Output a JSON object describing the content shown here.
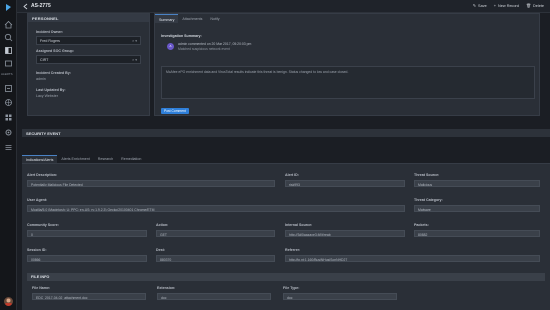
{
  "window": {
    "title": "AS-2775"
  },
  "topbar": {
    "actions": [
      {
        "icon": "save-icon",
        "glyph": "✎",
        "label": "Save"
      },
      {
        "icon": "plus-icon",
        "glyph": "+",
        "label": "New Record"
      },
      {
        "icon": "trash-icon",
        "glyph": "🗑",
        "label": "Delete"
      }
    ]
  },
  "rail": {
    "alert_label": "ALERTS",
    "icons": [
      "logo-icon",
      "home-icon",
      "search-icon",
      "app-icon",
      "workspace-icon",
      "alerts-icon",
      "grid-icon",
      "globe-icon",
      "list-icon",
      "gear-icon",
      "menu-icon"
    ]
  },
  "personnel": {
    "heading": "PERSONNEL",
    "owner_label": "Incident Owner:",
    "owner_value": "Fred Rogers",
    "group_label": "Assigned SOC Group:",
    "group_value": "CIRT",
    "created_label": "Incident Created By:",
    "created_value": "admin",
    "updated_label": "Last Updated By:",
    "updated_value": "Lacy Webster"
  },
  "summary": {
    "tabs": [
      "Summary",
      "Attachments",
      "Notify"
    ],
    "title": "Investigation Summary:",
    "comment_avatar": "A",
    "comment_meta": "admin commented on 20 Mar 2017, 05:20:03 pm",
    "comment_text": "Matched suspicious network event",
    "body": "McAfee ePO enrichment data and VirusTotal results indicate this threat is benign. Status changed to low and case closed.",
    "post_button": "Post Comment"
  },
  "security_event": {
    "heading": "SECURITY EVENT",
    "tabs": [
      "Indications/Alerts",
      "Alerts Enrichment",
      "Research",
      "Remediation"
    ],
    "fields": {
      "alert_desc_label": "Alert Description:",
      "alert_desc_value": "Potentially Malicious File Detected",
      "alert_id_label": "Alert ID:",
      "alert_id_value": "risk993",
      "threat_source_label": "Threat Source:",
      "threat_source_value": "Malicious",
      "user_agent_label": "User Agent:",
      "user_agent_value": "Mozilla/5.0 (Macintosh; U; PPC; en-US; rv:1.9.2.3) Gecko/20100401 Chrome/ETM",
      "threat_cat_label": "Threat Category:",
      "threat_cat_value": "Malware",
      "community_label": "Community Score:",
      "community_value": "0",
      "action_label": "Action:",
      "action_value": "GET",
      "internal_label": "Internal Source:",
      "internal_value": "http://3d0jaazaxe3.fi/i/t/reab",
      "packets_label": "Packets:",
      "packets_value": "80882",
      "session_label": "Session ID:",
      "session_value": "00866",
      "dest_label": "Dest:",
      "dest_value": "880370",
      "referrer_label": "Referrer:",
      "referrer_value": "http://ip.nt:1.160/BusiNHusiSonNHD27"
    },
    "file_info": {
      "heading": "FILE INFO",
      "name_label": "File Name:",
      "name_value": "EDC_2017-04-02_attachment.doc",
      "ext_label": "Extension:",
      "ext_value": "doc",
      "type_label": "File Type:",
      "type_value": "doc"
    }
  },
  "colors": {
    "accent": "#2f7fd9",
    "background": "#1b1e24",
    "panel": "#2a2f37"
  }
}
